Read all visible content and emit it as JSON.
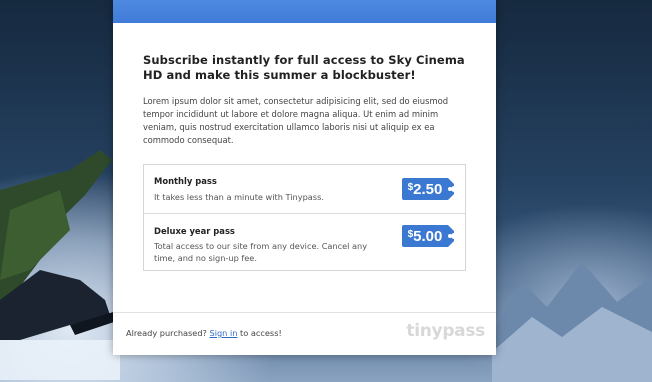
{
  "modal": {
    "headline": "Subscribe instantly for full access to Sky Cinema HD and make this summer a blockbuster!",
    "body": "Lorem ipsum dolor sit amet, consectetur adipisicing elit, sed do eiusmod tempor incididunt ut labore et dolore magna aliqua. Ut enim ad minim veniam, quis nostrud exercitation ullamco laboris nisi ut aliquip ex ea commodo consequat."
  },
  "offers": [
    {
      "name": "Monthly pass",
      "description": "It takes less than a minute with Tinypass.",
      "currency": "$",
      "amount": "2.50"
    },
    {
      "name": "Deluxe year pass",
      "description": "Total access to our site from any device. Cancel any time, and no sign-up fee.",
      "currency": "$",
      "amount": "5.00"
    }
  ],
  "footer": {
    "prefix": "Already purchased?",
    "link": "Sign in",
    "suffix": "to access!",
    "brand": "tinypass"
  },
  "colors": {
    "accent": "#3f7bd8",
    "price_tag": "#3a78d2",
    "link": "#2f6cc9"
  },
  "icons": [
    "price-tag-icon"
  ]
}
